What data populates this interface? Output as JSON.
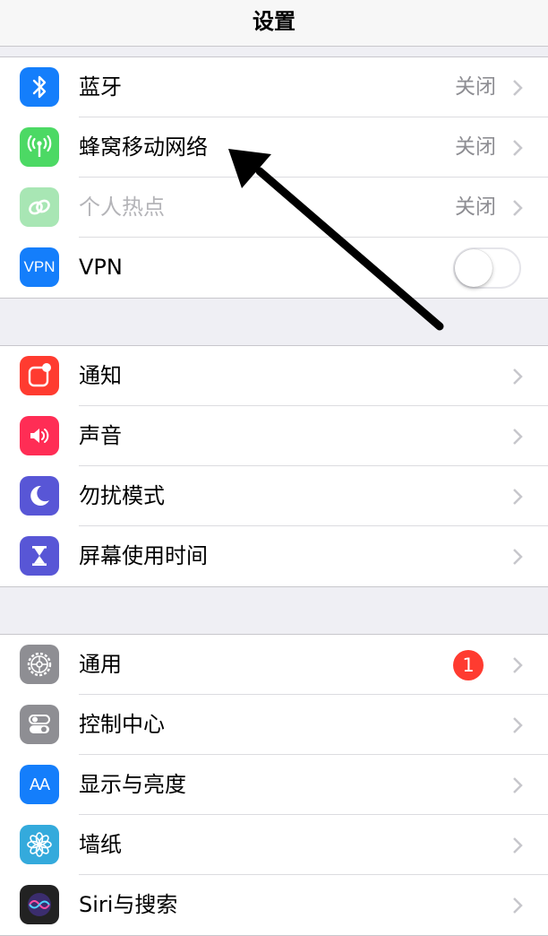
{
  "navbar": {
    "title": "设置"
  },
  "colors": {
    "bluetooth": "#147efb",
    "cellular": "#4cd964",
    "hotspot": "#a8e6b4",
    "vpn": "#147efb",
    "notifications": "#ff3b30",
    "sounds": "#ff2d55",
    "dnd": "#5856d6",
    "screentime": "#5856d6",
    "general": "#8e8e93",
    "control": "#8e8e93",
    "display": "#147efb",
    "wallpaper": "#34aadc",
    "siri": "#222222",
    "badge": "#ff3b30"
  },
  "sections": [
    {
      "rows": [
        {
          "label": "蓝牙",
          "value": "关闭",
          "icon": "bluetooth-icon"
        },
        {
          "label": "蜂窝移动网络",
          "value": "关闭",
          "icon": "cellular-antenna-icon"
        },
        {
          "label": "个人热点",
          "value": "关闭",
          "icon": "hotspot-link-icon",
          "disabled": true
        },
        {
          "label": "VPN",
          "icon_text": "VPN",
          "icon": "vpn-icon",
          "toggle": false
        }
      ]
    },
    {
      "rows": [
        {
          "label": "通知",
          "icon": "notifications-icon"
        },
        {
          "label": "声音",
          "icon": "speaker-icon"
        },
        {
          "label": "勿扰模式",
          "icon": "moon-icon"
        },
        {
          "label": "屏幕使用时间",
          "icon": "hourglass-icon"
        }
      ]
    },
    {
      "rows": [
        {
          "label": "通用",
          "icon": "gear-icon",
          "badge": "1"
        },
        {
          "label": "控制中心",
          "icon": "control-center-icon"
        },
        {
          "label": "显示与亮度",
          "icon": "display-brightness-icon",
          "icon_text": "AA"
        },
        {
          "label": "墙纸",
          "icon": "wallpaper-flower-icon"
        },
        {
          "label": "Siri与搜索",
          "icon": "siri-icon"
        }
      ]
    }
  ]
}
